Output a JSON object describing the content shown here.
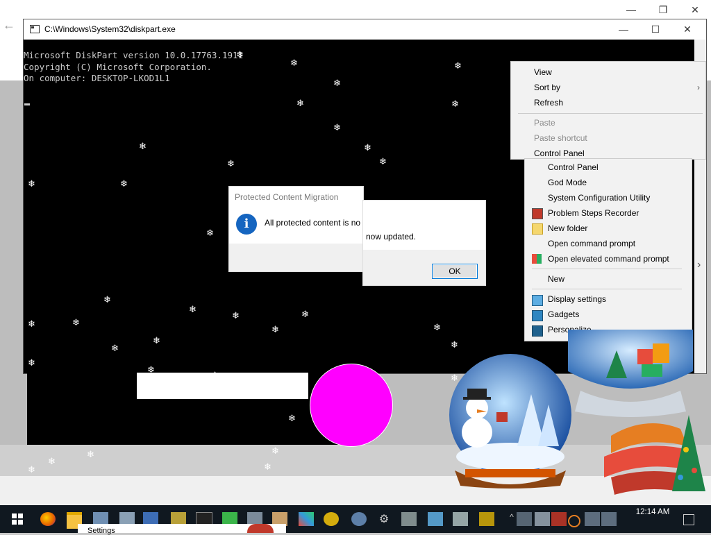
{
  "background_window": {
    "controls": [
      "—",
      "❐",
      "✕"
    ],
    "back_arrow": "←"
  },
  "console": {
    "title": "C:\\Windows\\System32\\diskpart.exe",
    "controls": [
      "—",
      "☐",
      "✕"
    ],
    "lines": [
      "Microsoft DiskPart version 10.0.17763.1911",
      "",
      "Copyright (C) Microsoft Corporation.",
      "On computer: DESKTOP-LKOD1L1"
    ]
  },
  "dialog": {
    "title": "Protected Content Migration",
    "message_part1": "All protected content is no",
    "message_part2": "now updated.",
    "ok_label": "OK",
    "icon": "info-icon"
  },
  "context_menu": {
    "items": [
      {
        "label": "View",
        "has_submenu": false
      },
      {
        "label": "Sort by",
        "has_submenu": true
      },
      {
        "label": "Refresh",
        "has_submenu": false
      },
      {
        "label": "Paste",
        "disabled": true
      },
      {
        "label": "Paste shortcut",
        "disabled": true
      },
      {
        "label": "Control Panel"
      }
    ],
    "submenu_items": [
      {
        "label": "Control Panel"
      },
      {
        "label": "God Mode"
      },
      {
        "label": "System Configuration Utility"
      },
      {
        "label": "Problem Steps Recorder",
        "icon": "steps-recorder-icon"
      },
      {
        "label": "New folder",
        "icon": "folder-icon"
      },
      {
        "label": "Open command prompt"
      },
      {
        "label": "Open elevated command prompt",
        "icon": "shield-icon"
      },
      {
        "label": "New",
        "has_submenu": true
      },
      {
        "label": "Display settings",
        "icon": "display-icon"
      },
      {
        "label": "Gadgets",
        "icon": "gadgets-icon"
      },
      {
        "label": "Personalize",
        "icon": "personalize-icon"
      }
    ]
  },
  "taskbar": {
    "time": "12:14 AM",
    "settings_label": "Settings"
  },
  "colors": {
    "console_bg": "#000000",
    "magenta": "#ff00ff",
    "taskbar": "#101820",
    "accent": "#0078d7"
  }
}
